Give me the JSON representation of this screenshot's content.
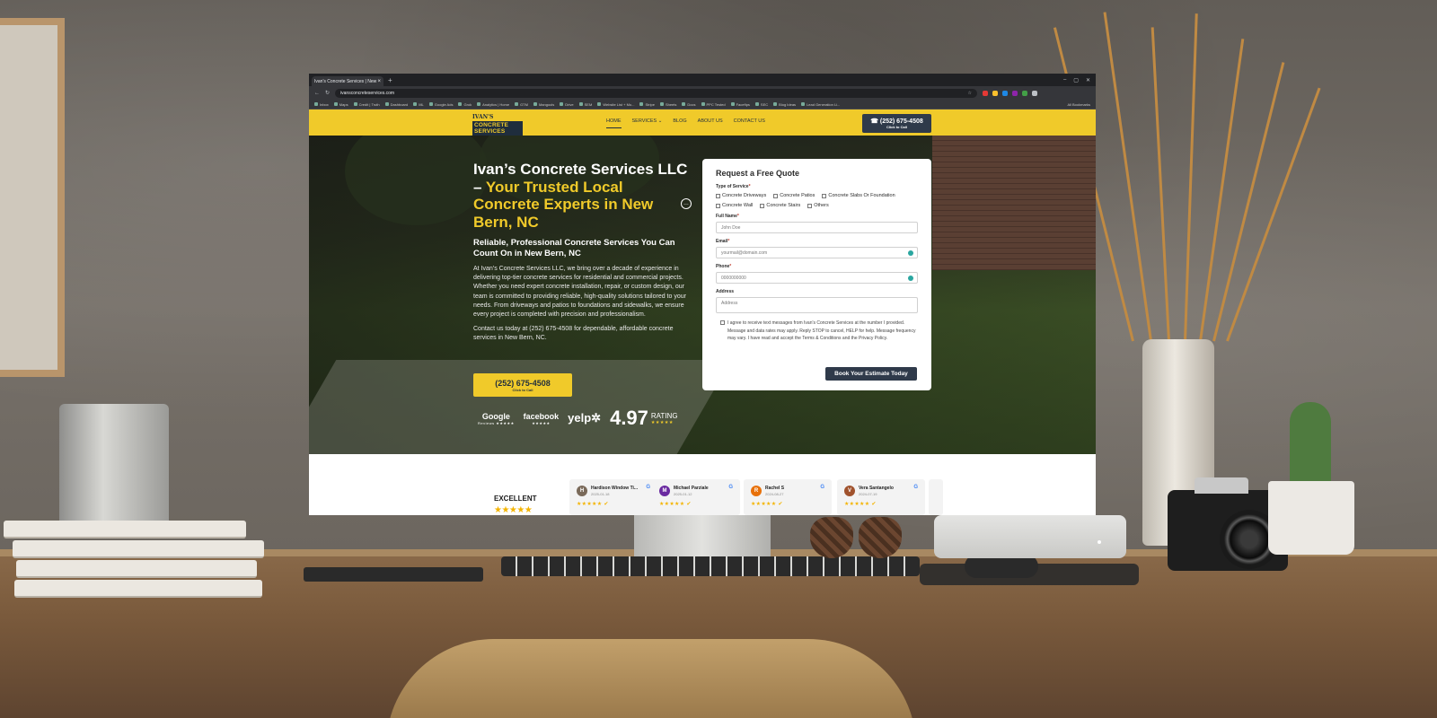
{
  "browser": {
    "tab_title": "Ivan's Concrete Services | New ...",
    "tab_close": "×",
    "new_tab": "+",
    "url": "ivansconcreteservices.com",
    "bookmarks": [
      "Inbox",
      "Maps",
      "Credit | Truth",
      "Dashboard",
      "ML",
      "Google Ads",
      "Grok",
      "Analytics | Home",
      "GTM",
      "Mangools",
      "Drive",
      "SEM",
      "Website List + Mo...",
      "Stripe",
      "Sheets",
      "Docs",
      "PPC Tested",
      "Faceftps",
      "SEC",
      "Blog Ideas",
      "Lead Generation Li..."
    ],
    "all_bookmarks": "All Bookmarks"
  },
  "site_nav": {
    "logo_top": "IVAN'S",
    "logo_bottom": "CONCRETE SERVICES",
    "items": [
      "HOME",
      "SERVICES ⌄",
      "BLOG",
      "ABOUT US",
      "CONTACT US"
    ],
    "call_number": "☎ (252) 675-4508",
    "call_sub": "Click to Call"
  },
  "hero": {
    "title_white": "Ivan’s Concrete Services LLC – ",
    "title_yellow": "Your Trusted Local Concrete Experts in New Bern, NC",
    "subtitle": "Reliable, Professional Concrete Services You Can Count On in New Bern, NC",
    "paragraph": "At Ivan’s Concrete Services LLC, we bring over a decade of experience in delivering top-tier concrete services for residential and commercial projects. Whether you need expert concrete installation, repair, or custom design, our team is committed to providing reliable, high-quality solutions tailored to your needs. From driveways and patios to foundations and sidewalks, we ensure every project is completed with precision and professionalism.",
    "paragraph2": "Contact us today at (252) 675-4508 for dependable, affordable concrete services in New Bern, NC.",
    "call_number": "(252) 675-4508",
    "call_sub": "Click to Call",
    "badges": [
      {
        "name": "Google",
        "sub": "Reviews ★★★★★"
      },
      {
        "name": "facebook",
        "sub": "★★★★★"
      },
      {
        "name": "yelp✲",
        "sub": ""
      }
    ],
    "rating_value": "4.97",
    "rating_label": "RATING",
    "rating_stars": "★★★★★"
  },
  "form": {
    "title": "Request a Free Quote",
    "service_label": "Type of Service",
    "services": [
      "Concrete Driveways",
      "Concrete Patios",
      "Concrete Slabs Or Foundation",
      "Concrete Wall",
      "Concrete Stairs",
      "Others"
    ],
    "name_label": "Full Name",
    "name_placeholder": "John Doe",
    "email_label": "Email",
    "email_placeholder": "yourmail@domain.com",
    "phone_label": "Phone",
    "phone_placeholder": "0000000000",
    "address_label": "Address",
    "address_placeholder": "Address",
    "required_mark": "*",
    "consent": "I agree to receive text messages from Ivan's Concrete Services at the number I provided. Message and data rates may apply. Reply STOP to cancel, HELP for help. Message frequency may vary. I have read and accept the Terms & Conditions and the Privacy Policy.",
    "submit": "Book Your Estimate Today"
  },
  "reviews": {
    "summary": "EXCELLENT",
    "summary_stars": "★★★★★",
    "cards": [
      {
        "initial": "H",
        "name": "Hardison Window Ti...",
        "date": "2025-01-18",
        "color": "#7a6a5a"
      },
      {
        "initial": "M",
        "name": "Michael Parziale",
        "date": "2025-01-12",
        "color": "#6a2aa0"
      },
      {
        "initial": "R",
        "name": "Rachel S",
        "date": "2024-08-27",
        "color": "#e8710a"
      },
      {
        "initial": "V",
        "name": "Vera Santangelo",
        "date": "2024-07-19",
        "color": "#a0522d"
      }
    ],
    "card_stars": "★★★★★ ✔",
    "google_mark": "G"
  },
  "colors": {
    "brand_yellow": "#f0ca2a",
    "brand_navy": "#2f3a4a"
  }
}
